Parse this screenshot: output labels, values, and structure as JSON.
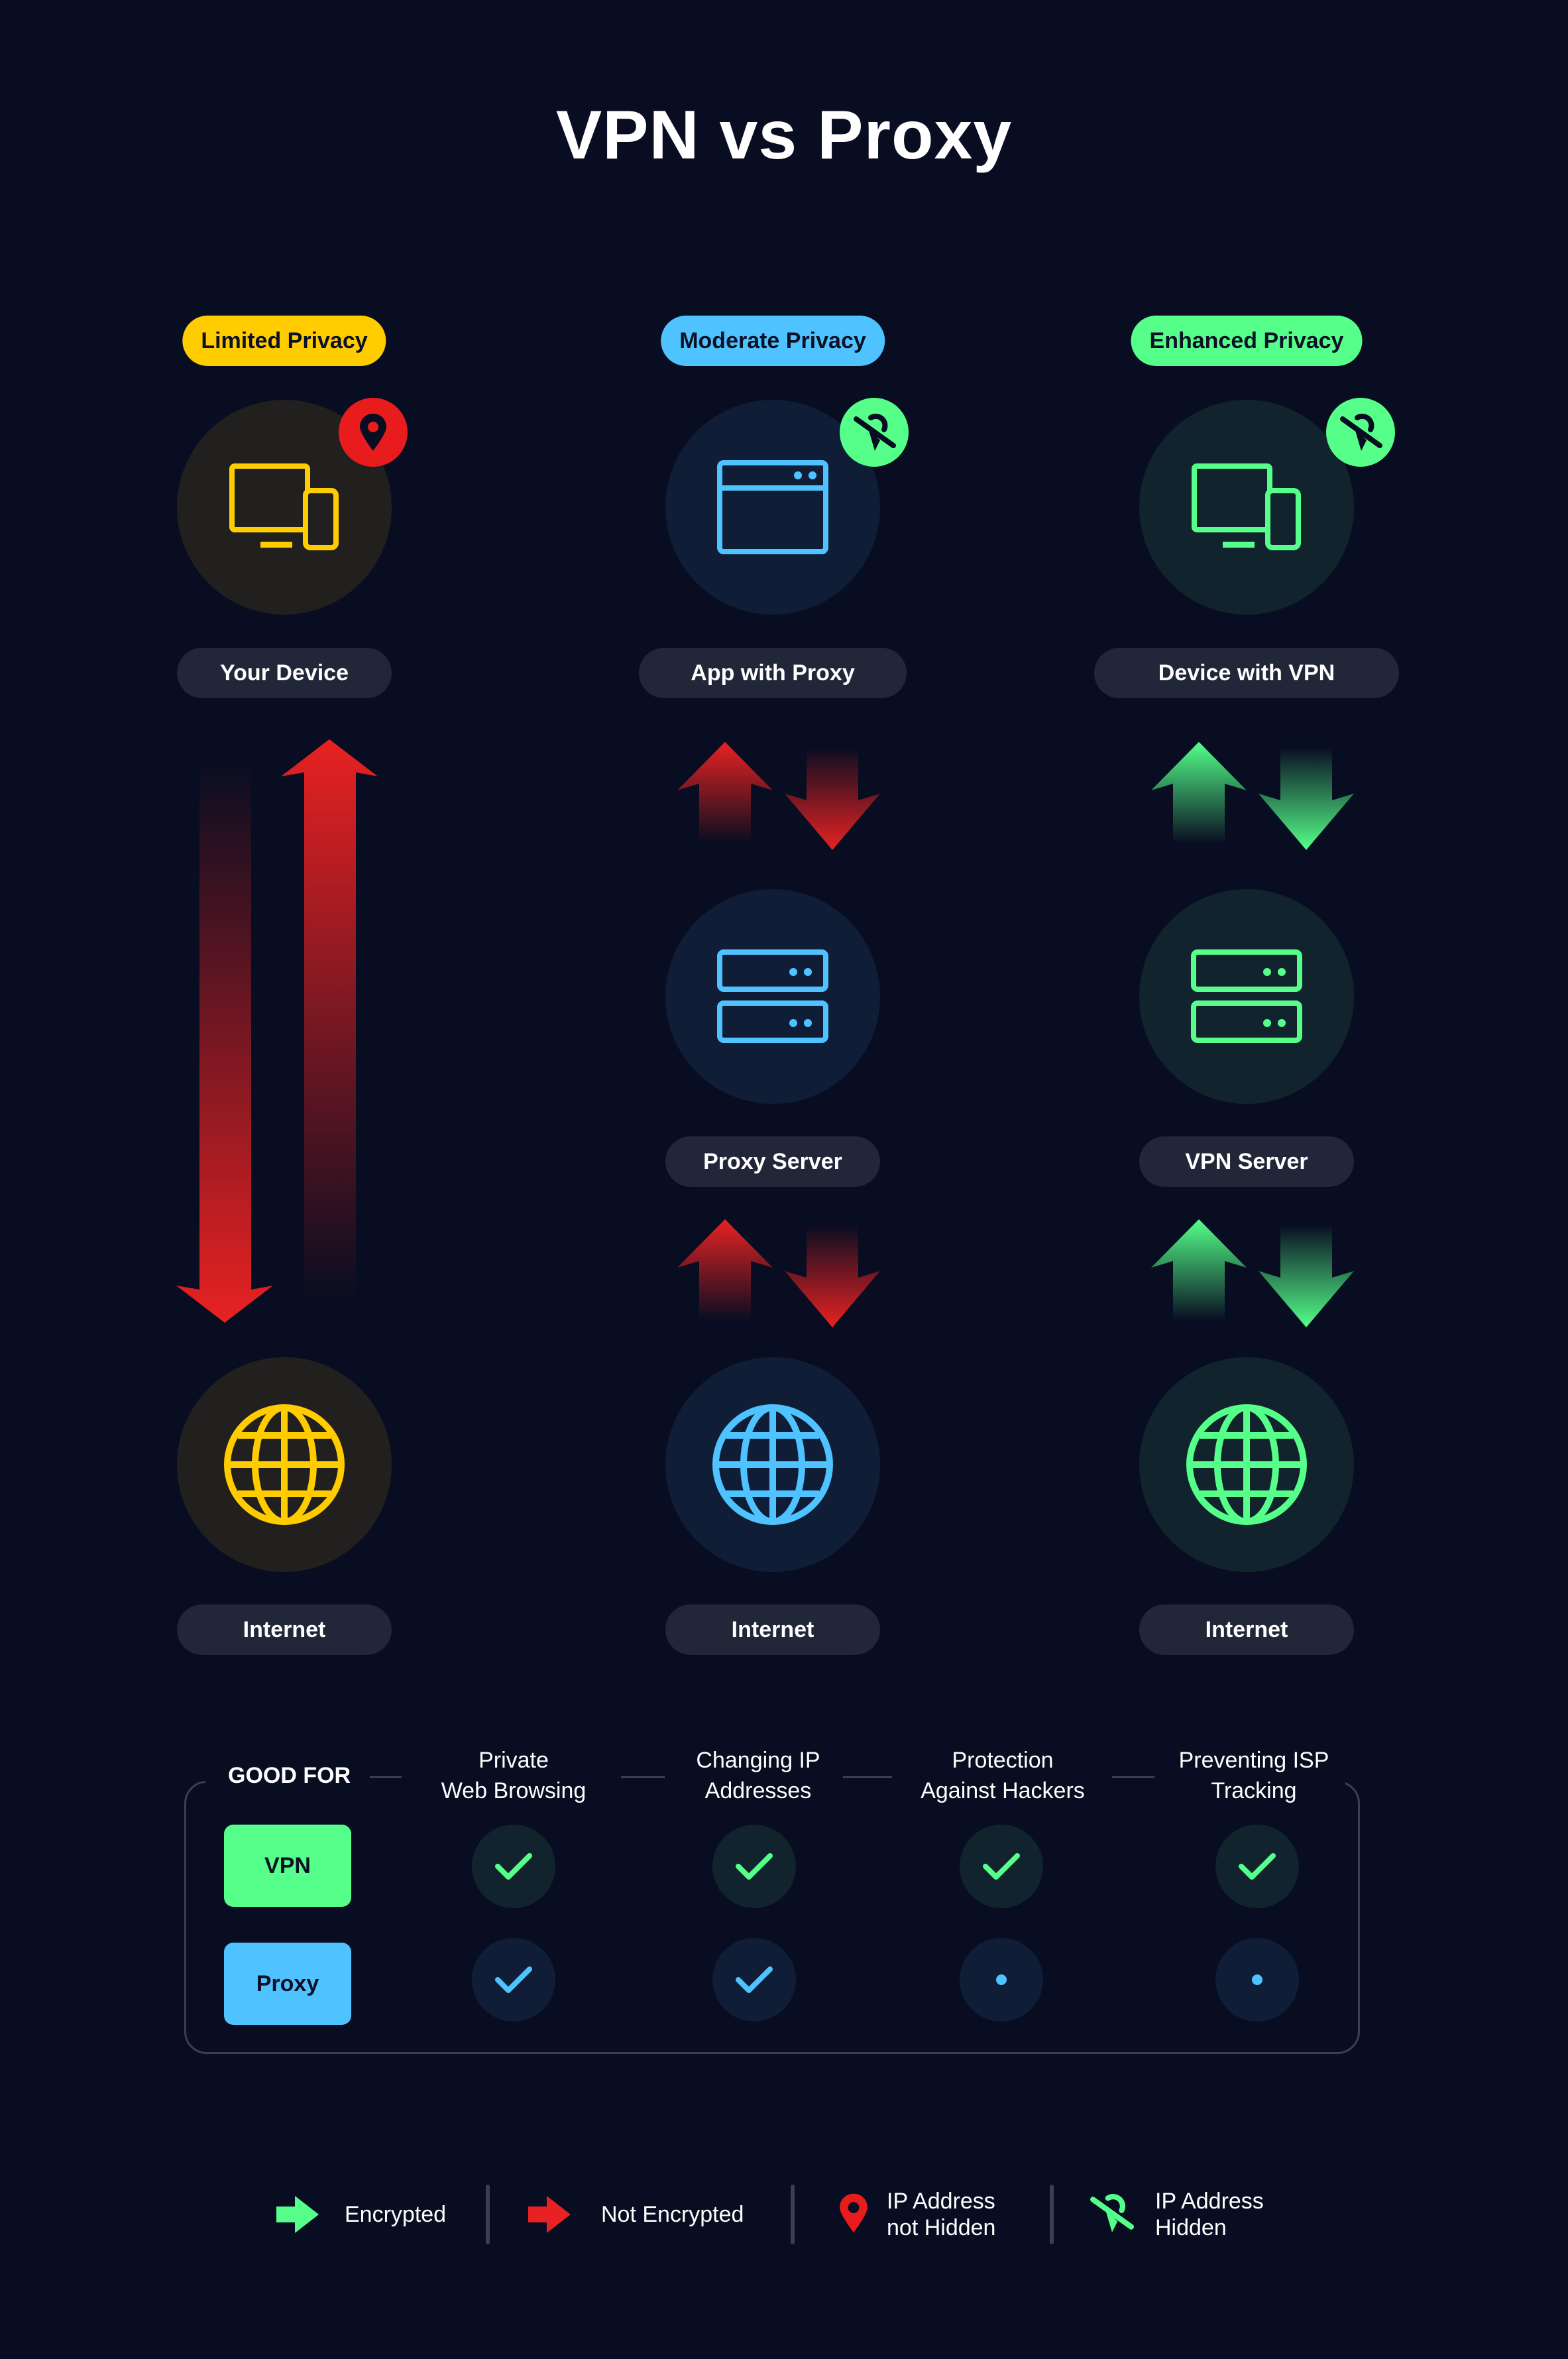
{
  "title": "VPN vs Proxy",
  "colors": {
    "background": "#080d21",
    "yellow": "#ffcc00",
    "blue": "#4fc3ff",
    "green": "#55ff8a",
    "red": "#e82222",
    "pill": "#212638"
  },
  "columns": [
    {
      "badge": "Limited Privacy",
      "top_node": {
        "label": "Your Device",
        "icon": "devices-icon"
      },
      "ip_marker": "location-pin-icon",
      "ip_status": "IP Address not Hidden",
      "middle_node": null,
      "bottom_node": {
        "label": "Internet",
        "icon": "globe-icon"
      },
      "encryption": "Not Encrypted"
    },
    {
      "badge": "Moderate Privacy",
      "top_node": {
        "label": "App with Proxy",
        "icon": "app-window-icon"
      },
      "ip_marker": "location-off-icon",
      "ip_status": "IP Address Hidden",
      "middle_node": {
        "label": "Proxy Server",
        "icon": "server-icon"
      },
      "bottom_node": {
        "label": "Internet",
        "icon": "globe-icon"
      },
      "encryption": "Not Encrypted"
    },
    {
      "badge": "Enhanced Privacy",
      "top_node": {
        "label": "Device with VPN",
        "icon": "devices-icon"
      },
      "ip_marker": "location-off-icon",
      "ip_status": "IP Address Hidden",
      "middle_node": {
        "label": "VPN Server",
        "icon": "server-icon"
      },
      "bottom_node": {
        "label": "Internet",
        "icon": "globe-icon"
      },
      "encryption": "Encrypted"
    }
  ],
  "table": {
    "header": "GOOD FOR",
    "columns": [
      "Private\nWeb Browsing",
      "Changing IP\nAddresses",
      "Protection\nAgainst Hackers",
      "Preventing ISP\nTracking"
    ],
    "rows": [
      {
        "label": "VPN",
        "values": [
          "check",
          "check",
          "check",
          "check"
        ]
      },
      {
        "label": "Proxy",
        "values": [
          "check",
          "check",
          "dot",
          "dot"
        ]
      }
    ]
  },
  "legend": [
    {
      "icon": "green-arrow-icon",
      "label": "Encrypted"
    },
    {
      "icon": "red-arrow-icon",
      "label": "Not Encrypted"
    },
    {
      "icon": "location-pin-icon",
      "label": "IP Address\nnot Hidden"
    },
    {
      "icon": "location-off-icon",
      "label": "IP Address\nHidden"
    }
  ]
}
